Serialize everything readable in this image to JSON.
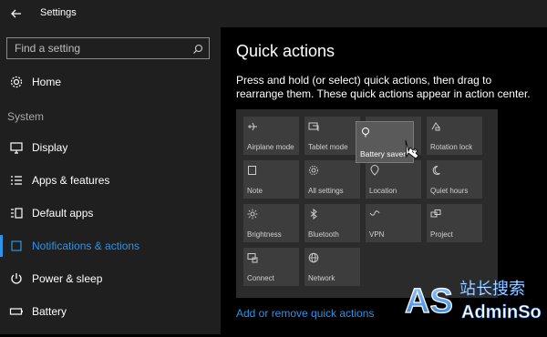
{
  "window": {
    "title": "Settings"
  },
  "sidebar": {
    "search_placeholder": "Find a setting",
    "home_label": "Home",
    "section_label": "System",
    "items": [
      {
        "label": "Display"
      },
      {
        "label": "Apps & features"
      },
      {
        "label": "Default apps"
      },
      {
        "label": "Notifications & actions"
      },
      {
        "label": "Power & sleep"
      },
      {
        "label": "Battery"
      }
    ]
  },
  "main": {
    "title": "Quick actions",
    "description": "Press and hold (or select) quick actions, then drag to rearrange them. These quick actions appear in action center.",
    "tiles": [
      {
        "label": "Airplane mode",
        "icon": "airplane-icon"
      },
      {
        "label": "Tablet mode",
        "icon": "tablet-mode-icon"
      },
      {
        "label": "Battery saver",
        "icon": "battery-saver-icon"
      },
      {
        "label": "Rotation lock",
        "icon": "rotation-lock-icon"
      },
      {
        "label": "Note",
        "icon": "note-icon"
      },
      {
        "label": "All settings",
        "icon": "gear-icon"
      },
      {
        "label": "Location",
        "icon": "location-icon"
      },
      {
        "label": "Quiet hours",
        "icon": "moon-icon"
      },
      {
        "label": "Brightness",
        "icon": "brightness-icon"
      },
      {
        "label": "Bluetooth",
        "icon": "bluetooth-icon"
      },
      {
        "label": "VPN",
        "icon": "vpn-icon"
      },
      {
        "label": "Project",
        "icon": "project-icon"
      },
      {
        "label": "Connect",
        "icon": "connect-icon"
      },
      {
        "label": "Network",
        "icon": "globe-icon"
      }
    ],
    "link": "Add or remove quick actions"
  },
  "watermark": {
    "letters": "AS",
    "cn": "站长搜索",
    "brand": "AdminSo"
  },
  "colors": {
    "accent": "#2f92e6",
    "sidebar_bg": "#1f1f1f",
    "tile_bg": "#3d3d3d"
  }
}
